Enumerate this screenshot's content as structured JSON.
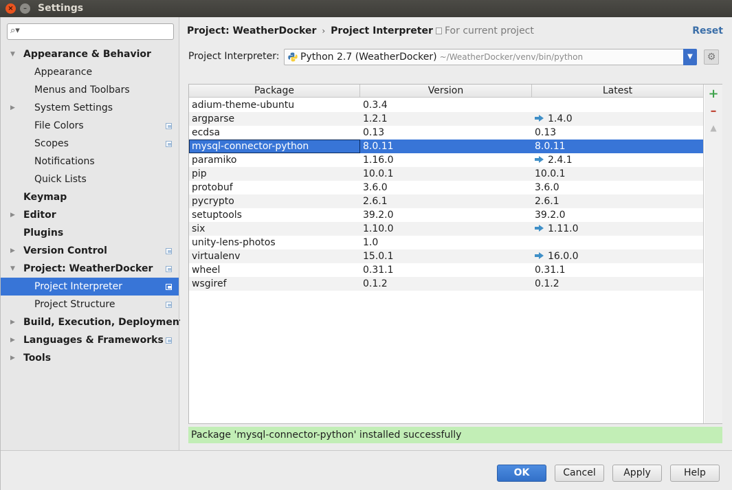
{
  "window": {
    "title": "Settings"
  },
  "search": {
    "value": "",
    "placeholder": ""
  },
  "sidebar": {
    "items": [
      {
        "label": "Appearance & Behavior",
        "level": 0,
        "bold": true,
        "arrow": "▼",
        "scope": false
      },
      {
        "label": "Appearance",
        "level": 1,
        "bold": false,
        "arrow": "",
        "scope": false
      },
      {
        "label": "Menus and Toolbars",
        "level": 1,
        "bold": false,
        "arrow": "",
        "scope": false
      },
      {
        "label": "System Settings",
        "level": 1,
        "bold": false,
        "arrow": "▶",
        "scope": false
      },
      {
        "label": "File Colors",
        "level": 1,
        "bold": false,
        "arrow": "",
        "scope": true
      },
      {
        "label": "Scopes",
        "level": 1,
        "bold": false,
        "arrow": "",
        "scope": true
      },
      {
        "label": "Notifications",
        "level": 1,
        "bold": false,
        "arrow": "",
        "scope": false
      },
      {
        "label": "Quick Lists",
        "level": 1,
        "bold": false,
        "arrow": "",
        "scope": false
      },
      {
        "label": "Keymap",
        "level": 0,
        "bold": true,
        "arrow": "",
        "scope": false
      },
      {
        "label": "Editor",
        "level": 0,
        "bold": true,
        "arrow": "▶",
        "scope": false
      },
      {
        "label": "Plugins",
        "level": 0,
        "bold": true,
        "arrow": "",
        "scope": false
      },
      {
        "label": "Version Control",
        "level": 0,
        "bold": true,
        "arrow": "▶",
        "scope": true
      },
      {
        "label": "Project: WeatherDocker",
        "level": 0,
        "bold": true,
        "arrow": "▼",
        "scope": true
      },
      {
        "label": "Project Interpreter",
        "level": 1,
        "bold": false,
        "arrow": "",
        "scope": true,
        "selected": true
      },
      {
        "label": "Project Structure",
        "level": 1,
        "bold": false,
        "arrow": "",
        "scope": true
      },
      {
        "label": "Build, Execution, Deployment",
        "level": 0,
        "bold": true,
        "arrow": "▶",
        "scope": false
      },
      {
        "label": "Languages & Frameworks",
        "level": 0,
        "bold": true,
        "arrow": "▶",
        "scope": true
      },
      {
        "label": "Tools",
        "level": 0,
        "bold": true,
        "arrow": "▶",
        "scope": false
      }
    ]
  },
  "header": {
    "crumb_project": "Project: WeatherDocker",
    "crumb_sep": "›",
    "crumb_page": "Project Interpreter",
    "for_current": "For current project",
    "reset": "Reset"
  },
  "interpreter": {
    "label": "Project Interpreter:",
    "name": "Python 2.7 (WeatherDocker)",
    "path": "~/WeatherDocker/venv/bin/python"
  },
  "table": {
    "headers": [
      "Package",
      "Version",
      "Latest"
    ],
    "rows": [
      {
        "package": "adium-theme-ubuntu",
        "version": "0.3.4",
        "latest": "",
        "upgrade": false
      },
      {
        "package": "argparse",
        "version": "1.2.1",
        "latest": "1.4.0",
        "upgrade": true
      },
      {
        "package": "ecdsa",
        "version": "0.13",
        "latest": "0.13",
        "upgrade": false
      },
      {
        "package": "mysql-connector-python",
        "version": "8.0.11",
        "latest": "8.0.11",
        "upgrade": false,
        "selected": true
      },
      {
        "package": "paramiko",
        "version": "1.16.0",
        "latest": "2.4.1",
        "upgrade": true
      },
      {
        "package": "pip",
        "version": "10.0.1",
        "latest": "10.0.1",
        "upgrade": false
      },
      {
        "package": "protobuf",
        "version": "3.6.0",
        "latest": "3.6.0",
        "upgrade": false
      },
      {
        "package": "pycrypto",
        "version": "2.6.1",
        "latest": "2.6.1",
        "upgrade": false
      },
      {
        "package": "setuptools",
        "version": "39.2.0",
        "latest": "39.2.0",
        "upgrade": false
      },
      {
        "package": "six",
        "version": "1.10.0",
        "latest": "1.11.0",
        "upgrade": true
      },
      {
        "package": "unity-lens-photos",
        "version": "1.0",
        "latest": "",
        "upgrade": false
      },
      {
        "package": "virtualenv",
        "version": "15.0.1",
        "latest": "16.0.0",
        "upgrade": true
      },
      {
        "package": "wheel",
        "version": "0.31.1",
        "latest": "0.31.1",
        "upgrade": false
      },
      {
        "package": "wsgiref",
        "version": "0.1.2",
        "latest": "0.1.2",
        "upgrade": false
      }
    ]
  },
  "status": {
    "message": "Package 'mysql-connector-python' installed successfully"
  },
  "footer": {
    "ok": "OK",
    "cancel": "Cancel",
    "apply": "Apply",
    "help": "Help"
  },
  "colors": {
    "selection": "#3875d7",
    "status_bg": "#c2eeb6",
    "link": "#3a6ea8",
    "add": "#3fa34d",
    "remove": "#c14a3a"
  }
}
